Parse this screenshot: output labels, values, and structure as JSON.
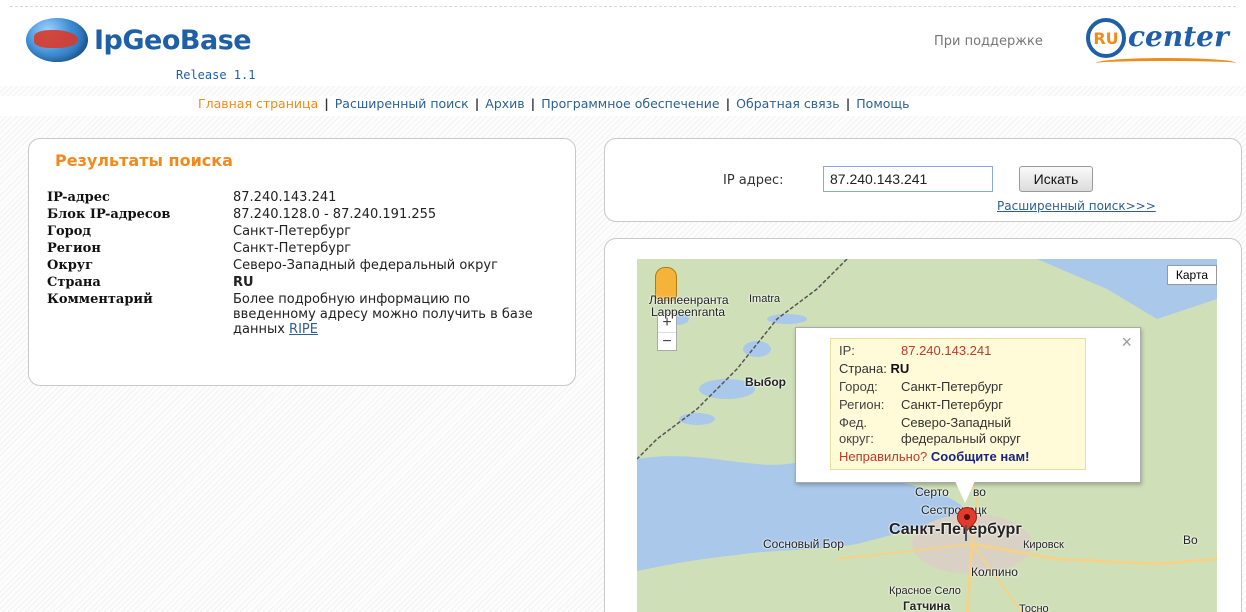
{
  "header": {
    "logo_text": "IpGeoBase",
    "release": "Release 1.1",
    "support": "При поддержке",
    "partner_logo_letters": "RU",
    "partner_logo_word": "center"
  },
  "nav": {
    "items": [
      {
        "label": "Главная страница",
        "active": true
      },
      {
        "label": "Расширенный поиск",
        "active": false
      },
      {
        "label": "Архив",
        "active": false
      },
      {
        "label": "Программное обеспечение",
        "active": false
      },
      {
        "label": "Обратная связь",
        "active": false
      },
      {
        "label": "Помощь",
        "active": false
      }
    ],
    "separator": "|"
  },
  "results": {
    "title": "Результаты поиска",
    "rows": [
      {
        "key": "IP-адрес",
        "value": "87.240.143.241"
      },
      {
        "key": "Блок IP-адресов",
        "value": "87.240.128.0 - 87.240.191.255"
      },
      {
        "key": "Город",
        "value": "Санкт-Петербург"
      },
      {
        "key": "Регион",
        "value": "Санкт-Петербург"
      },
      {
        "key": "Округ",
        "value": "Северо-Западный федеральный округ"
      },
      {
        "key": "Страна",
        "value": "RU"
      },
      {
        "key": "Комментарий",
        "value": "Более подробную информацию по введенному адресу можно получить в базе данных "
      }
    ],
    "ripe_link": "RIPE"
  },
  "search": {
    "label": "IP адрес:",
    "value": "87.240.143.241",
    "button": "Искать",
    "advanced_link": "Расширенный поиск>>>"
  },
  "map": {
    "type_button": "Карта",
    "zoom_in": "+",
    "zoom_out": "−",
    "places": {
      "lappeenranta": "Лаппеенранта",
      "lappeenranta_fi": "Lappeenranta",
      "imatra": "Imatra",
      "vyborg": "Выбор",
      "sertolovo": "Серто",
      "sertolovo_end": "во",
      "sestroretsk": "Сестрорецк",
      "spb": "Санкт-Петербург",
      "sosnovy_bor": "Сосновый Бор",
      "kirovsk": "Кировск",
      "kolpino": "Колпино",
      "krasnoe_selo": "Красное Село",
      "gatchina": "Гатчина",
      "tosno": "Тосно",
      "bo": "Во"
    },
    "popup": {
      "close": "×",
      "ip_label": "IP:",
      "ip_value": "87.240.143.241",
      "country_label": "Страна:",
      "country_value": "RU",
      "city_label": "Город:",
      "city_value": "Санкт-Петербург",
      "region_label": "Регион:",
      "region_value": "Санкт-Петербург",
      "district_label": "Фед. округ:",
      "district_value": "Северо-Западный федеральный округ",
      "wrong": "Неправильно?",
      "report": "Сообщите нам!"
    }
  }
}
